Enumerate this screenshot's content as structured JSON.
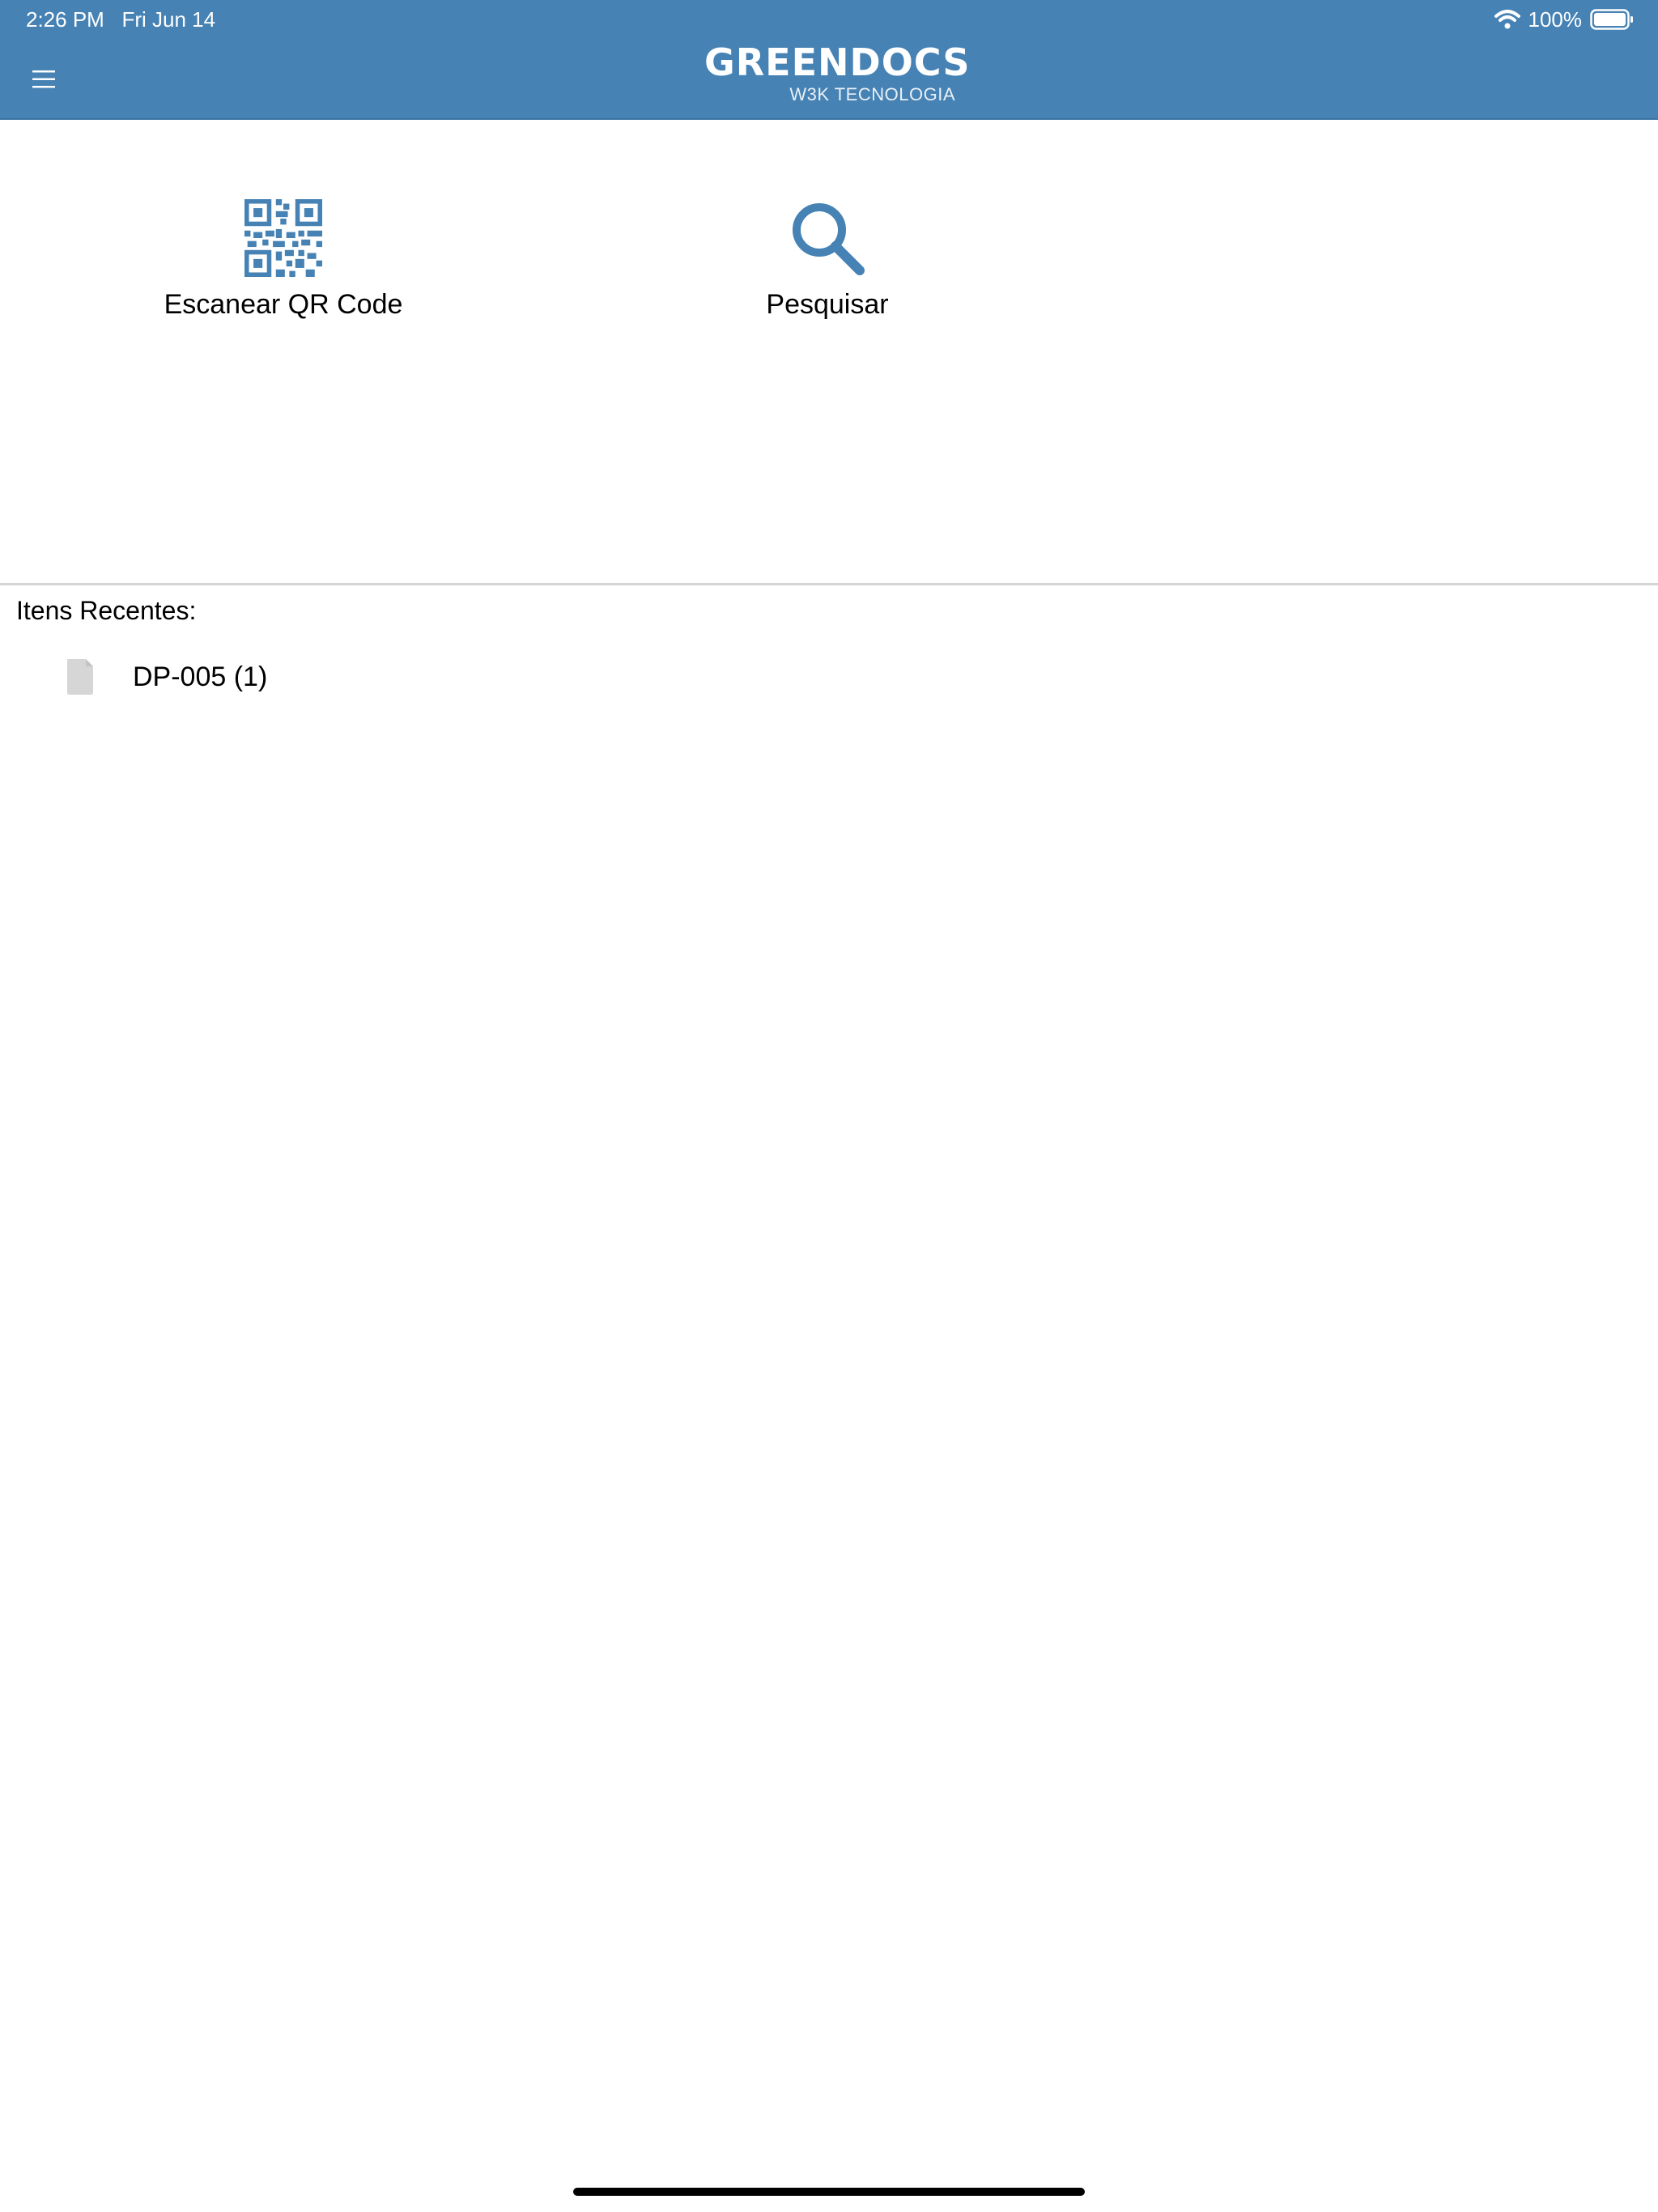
{
  "status_bar": {
    "time": "2:26 PM",
    "date": "Fri Jun 14",
    "battery": "100%",
    "icons": [
      "wifi-icon",
      "battery-icon"
    ]
  },
  "nav_bar": {
    "brand_title": "GREENDOCS",
    "brand_subtitle": "W3K TECNOLOGIA",
    "menu_icon": "hamburger-menu-icon"
  },
  "actions": [
    {
      "label": "Escanear QR Code",
      "icon": "qr-code-icon"
    },
    {
      "label": "Pesquisar",
      "icon": "search-icon"
    }
  ],
  "recent": {
    "heading": "Itens Recentes:",
    "items": [
      {
        "label": "DP-005 (1)",
        "icon": "document-icon"
      }
    ]
  },
  "colors": {
    "header_bg": "#4682b4",
    "accent": "#4682b4",
    "divider": "#d4d4d4",
    "document_icon": "#d6d6d6"
  }
}
